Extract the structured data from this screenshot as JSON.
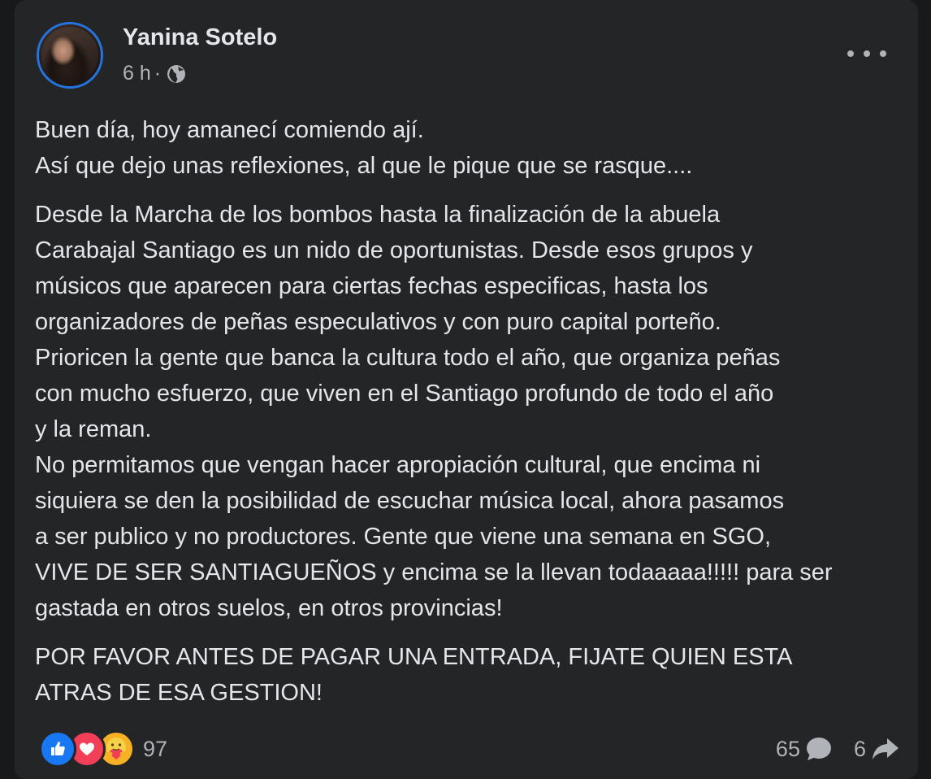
{
  "post": {
    "author": "Yanina Sotelo",
    "time": "6 h",
    "separator": "·",
    "audience_icon": "globe-icon",
    "paragraphs": [
      "Buen día, hoy amanecí comiendo ají.\nAsí que dejo unas reflexiones, al que le pique que se rasque....",
      "Desde la Marcha de los bombos hasta la finalización de la abuela\nCarabajal Santiago es un nido de oportunistas. Desde esos grupos y\nmúsicos que aparecen para ciertas fechas especificas, hasta los\norganizadores de peñas especulativos y con puro capital porteño.\nPrioricen la gente que banca la cultura todo el año, que organiza peñas\ncon mucho esfuerzo, que viven en el Santiago profundo de todo el año\ny  la reman.\nNo permitamos que vengan hacer apropiación cultural, que encima ni\nsiquiera se den la posibilidad de escuchar música local, ahora pasamos\na ser publico y no productores. Gente que viene una semana en SGO,\nVIVE DE SER SANTIAGUEÑOS y encima se la llevan todaaaaa!!!!! para ser\ngastada en otros suelos, en otros provincias!",
      "POR FAVOR ANTES DE PAGAR UNA ENTRADA, FIJATE QUIEN ESTA\nATRAS DE ESA GESTION!"
    ]
  },
  "reactions": {
    "icons": [
      "like-icon",
      "love-icon",
      "care-icon"
    ],
    "count": "97"
  },
  "stats": {
    "comments": "65",
    "shares": "6"
  },
  "colors": {
    "card_bg": "#242526",
    "text": "#e4e6eb",
    "secondary_text": "#b0b3b8",
    "accent": "#2374e1"
  }
}
